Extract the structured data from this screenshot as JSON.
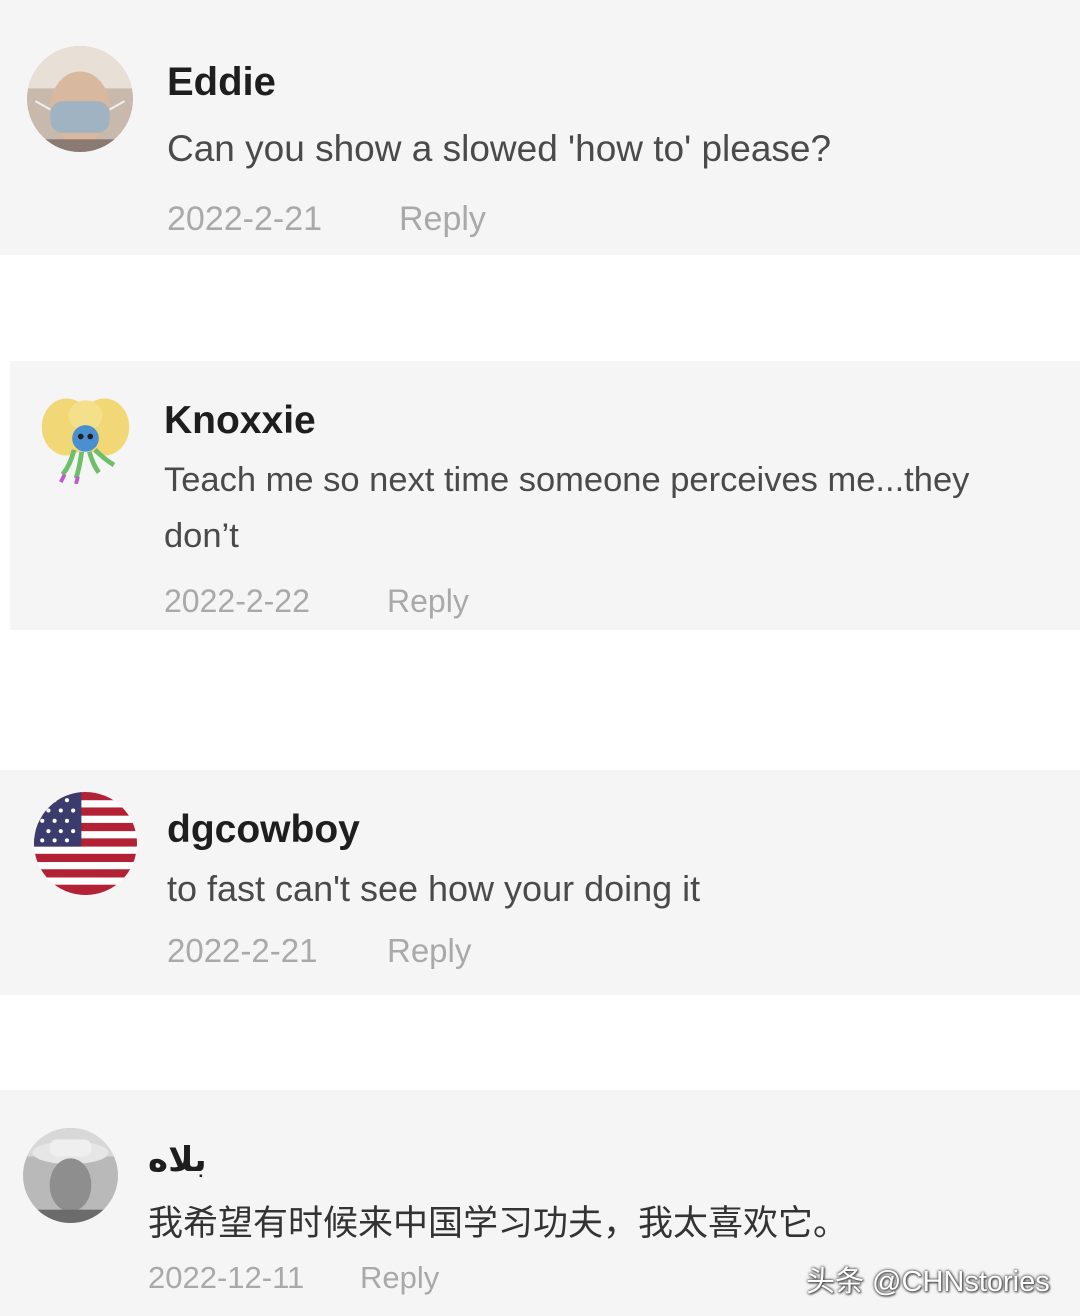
{
  "comments": [
    {
      "username": "Eddie",
      "text": "Can you show a slowed 'how to' please?",
      "date": "2022-2-21",
      "reply_label": "Reply",
      "avatar": "masked-person-avatar"
    },
    {
      "username": "Knoxxie",
      "text_line1": "Teach me so next time someone perceives me...they",
      "text_line2": "don’t",
      "date": "2022-2-22",
      "reply_label": "Reply",
      "avatar": "cartoon-creature-avatar"
    },
    {
      "username": "dgcowboy",
      "text": "to fast can't see how your doing it",
      "date": "2022-2-21",
      "reply_label": "Reply",
      "avatar": "us-flag-avatar"
    },
    {
      "username": "بلاه",
      "text": "我希望有时候来中国学习功夫，我太喜欢它。",
      "date": "2022-12-11",
      "reply_label": "Reply",
      "avatar": "person-with-hat-avatar"
    }
  ],
  "watermark": "头条 @CHNstories",
  "colors": {
    "card_bg": "#f5f5f5",
    "username": "#1e1e1e",
    "comment_text": "#4a4a4a",
    "meta_text": "#a9a9a9"
  }
}
